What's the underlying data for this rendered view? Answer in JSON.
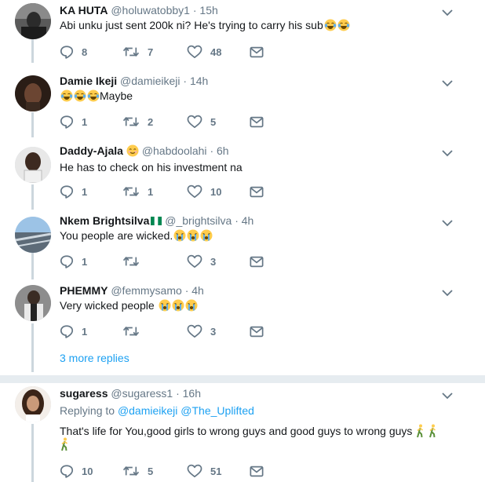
{
  "tweets": [
    {
      "name": "KA HUTA",
      "handle": "@holuwatobby1",
      "time": "15h",
      "text": "Abi unku just sent 200k ni? He's trying to carry his sub",
      "replies": "8",
      "retweets": "7",
      "likes": "48"
    },
    {
      "name": "Damie Ikeji",
      "handle": "@damieikeji",
      "time": "14h",
      "text": "Maybe",
      "replies": "1",
      "retweets": "2",
      "likes": "5"
    },
    {
      "name": "Daddy-Ajala",
      "handle": "@habdoolahi",
      "time": "6h",
      "text": "He has to check on his investment na",
      "replies": "1",
      "retweets": "1",
      "likes": "10"
    },
    {
      "name": "Nkem Brightsilva",
      "handle": "@_brightsilva",
      "time": "4h",
      "text": "You people are wicked.",
      "replies": "1",
      "retweets": "",
      "likes": "3"
    },
    {
      "name": "PHEMMY",
      "handle": "@femmysamo",
      "time": "4h",
      "text": "Very wicked people",
      "replies": "1",
      "retweets": "",
      "likes": "3"
    },
    {
      "name": "sugaress",
      "handle": "@sugaress1",
      "time": "16h",
      "replying_label": "Replying to",
      "replying_1": "@damieikeji",
      "replying_2": "@The_Uplifted",
      "text": "That's life for You,good girls to wrong guys and good guys to wrong guys",
      "replies": "10",
      "retweets": "5",
      "likes": "51"
    }
  ],
  "more_replies": "3 more replies",
  "dot": "·",
  "colors": {
    "accent": "#1da1f2",
    "muted": "#657786",
    "line": "#ccd6dd",
    "separator": "#e6ecf0"
  },
  "icons": [
    "reply-icon",
    "retweet-icon",
    "like-icon",
    "dm-icon",
    "chevron-down-icon",
    "laughing-emoji",
    "crying-emoji",
    "smiling-emoji",
    "nigeria-flag",
    "walking-emoji"
  ]
}
